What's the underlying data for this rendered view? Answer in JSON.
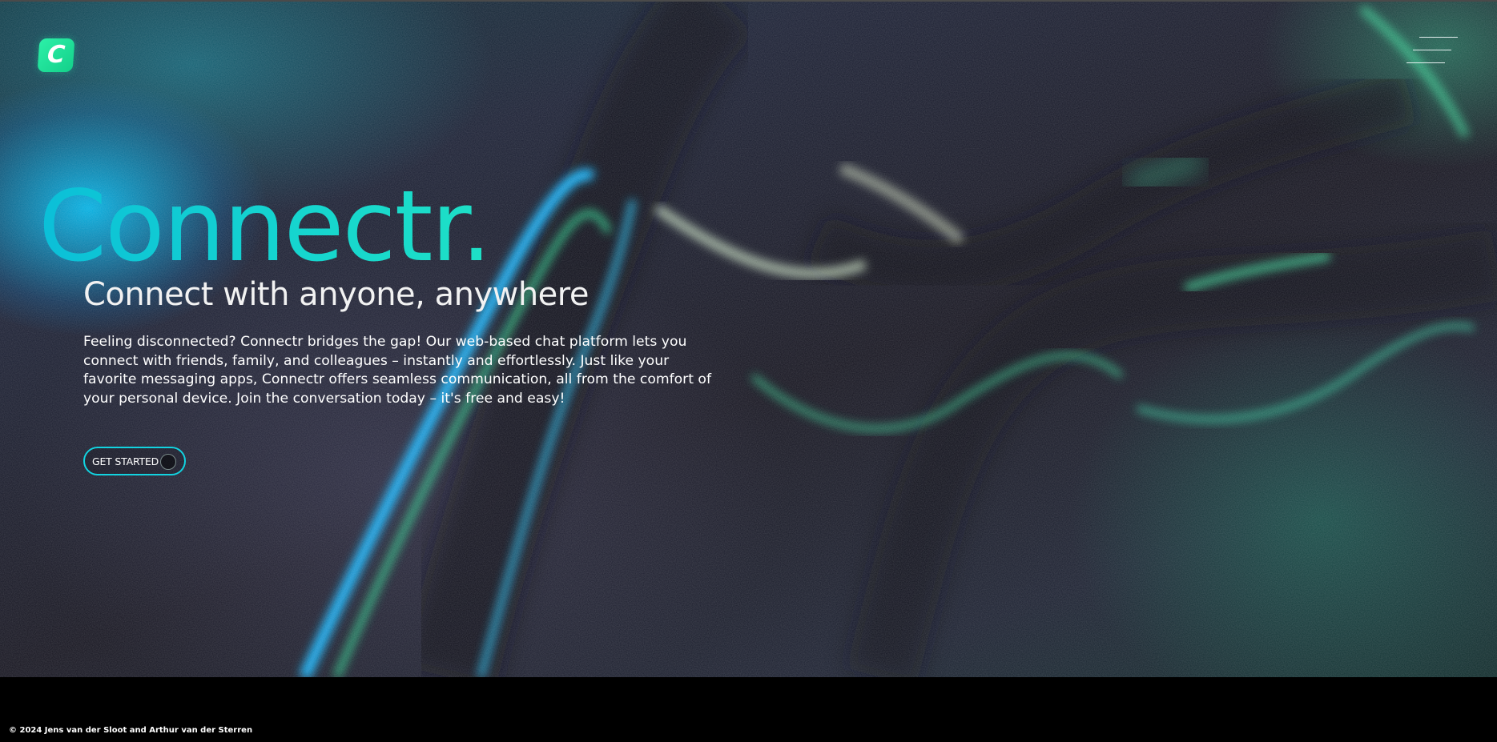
{
  "brand": {
    "logo_letter": "C",
    "title": "Connectr."
  },
  "hero": {
    "tagline": "Connect with anyone, anywhere",
    "description": "Feeling disconnected? Connectr bridges the gap! Our web-based chat platform lets you connect with friends, family, and colleagues – instantly and effortlessly. Just like your favorite messaging apps, Connectr offers seamless communication, all from the comfort of your personal device. Join the conversation today – it's free and easy!",
    "cta_label": "GET STARTED"
  },
  "header": {
    "menu_icon": "hamburger-menu-icon"
  },
  "footer": {
    "copyright": "© 2024 Jens van der Sloot and Arthur van der Sterren"
  },
  "colors": {
    "accent": "#14d3d0",
    "logo": "#1ee39a",
    "background": "#000000",
    "text": "#ffffff"
  }
}
